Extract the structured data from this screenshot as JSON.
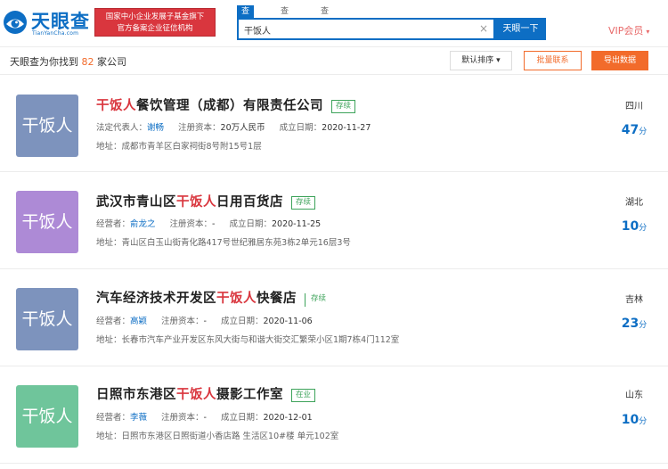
{
  "header": {
    "logo_text": "天眼查",
    "logo_sub": "TianYanCha.com",
    "banner_line1": "国家中小企业发展子基金旗下",
    "banner_line2": "官方备案企业征信机构",
    "tabs": [
      {
        "label": "查公司",
        "active": true
      },
      {
        "label": "查老板",
        "active": false
      },
      {
        "label": "查关系",
        "active": false
      }
    ],
    "search_value": "干饭人",
    "search_clear": "×",
    "search_button": "天眼一下",
    "vip_label": "VIP会员",
    "vip_caret": "▾"
  },
  "toolbar": {
    "count_prefix": "天眼查为你找到",
    "count_value": "82",
    "count_suffix": "家公司",
    "sort_label": "默认排序 ▾",
    "batch_label": "批量联系",
    "export_label": "导出数据"
  },
  "results": [
    {
      "avatar_text": "干饭人",
      "avatar_color": "#7d93bd",
      "name_prefix": "",
      "name_highlight": "干饭人",
      "name_suffix": "餐饮管理（成都）有限责任公司",
      "status": "存续",
      "person_label": "法定代表人：",
      "person": "谢畅",
      "capital_label": "注册资本：",
      "capital": "20万人民币",
      "date_label": "成立日期：",
      "date": "2020-11-27",
      "address_label": "地址：",
      "address": "成都市青羊区白家祠街8号附15号1层",
      "region": "四川",
      "score": "47",
      "score_unit": "分"
    },
    {
      "avatar_text": "干饭人",
      "avatar_color": "#ad8ad6",
      "name_prefix": "武汉市青山区",
      "name_highlight": "干饭人",
      "name_suffix": "日用百货店",
      "status": "存续",
      "person_label": "经营者：",
      "person": "俞龙之",
      "capital_label": "注册资本：",
      "capital": "-",
      "date_label": "成立日期：",
      "date": "2020-11-25",
      "address_label": "地址：",
      "address": "青山区白玉山街青化路417号世纪雅居东苑3栋2单元16层3号",
      "region": "湖北",
      "score": "10",
      "score_unit": "分"
    },
    {
      "avatar_text": "干饭人",
      "avatar_color": "#7d93bd",
      "name_prefix": "汽车经济技术开发区",
      "name_highlight": "干饭人",
      "name_suffix": "快餐店",
      "status": "存续",
      "person_label": "经营者：",
      "person": "高颖",
      "capital_label": "注册资本：",
      "capital": "-",
      "date_label": "成立日期：",
      "date": "2020-11-06",
      "address_label": "地址：",
      "address": "长春市汽车产业开发区东风大街与和谐大街交汇繁荣小区1期7栋4门112室",
      "region": "吉林",
      "score": "23",
      "score_unit": "分"
    },
    {
      "avatar_text": "干饭人",
      "avatar_color": "#6fc59b",
      "name_prefix": "日照市东港区",
      "name_highlight": "干饭人",
      "name_suffix": "摄影工作室",
      "status": "在业",
      "person_label": "经营者：",
      "person": "李薇",
      "capital_label": "注册资本：",
      "capital": "-",
      "date_label": "成立日期：",
      "date": "2020-12-01",
      "address_label": "地址：",
      "address": "日照市东港区日照街道小香店路 生活区10#楼 单元102室",
      "region": "山东",
      "score": "10",
      "score_unit": "分"
    }
  ]
}
